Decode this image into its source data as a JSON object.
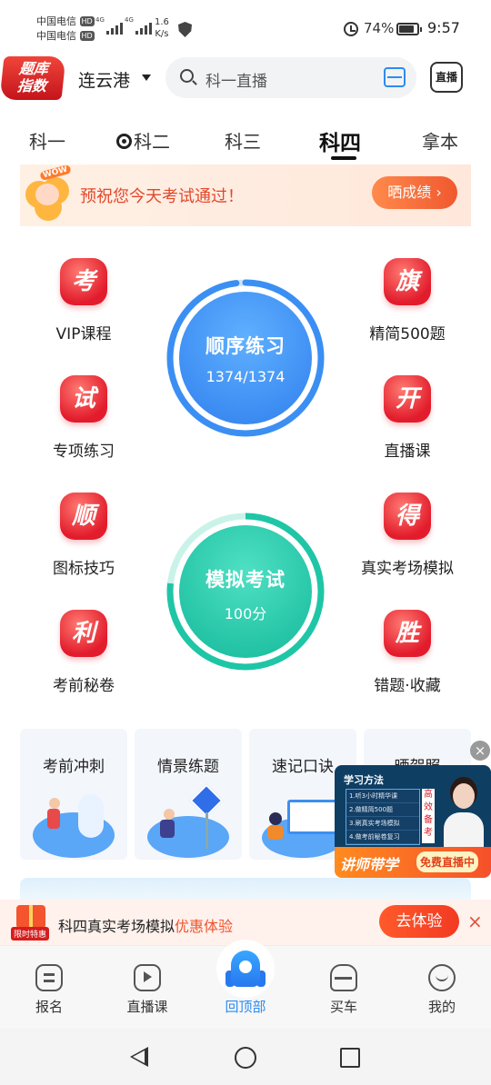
{
  "status": {
    "carrier1": "中国电信",
    "carrier2": "中国电信",
    "hd": "HD",
    "net1": "4G",
    "net2": "4G",
    "speed_value": "1.6",
    "speed_unit": "K/s",
    "battery": "74%",
    "time": "9:57"
  },
  "header": {
    "logo_line1": "题库",
    "logo_line2": "指数",
    "city": "连云港",
    "search_placeholder": "科一直播",
    "live_label": "直播"
  },
  "tabs": [
    {
      "label": "科一"
    },
    {
      "label": "科二"
    },
    {
      "label": "科三"
    },
    {
      "label": "科四"
    },
    {
      "label": "拿本"
    }
  ],
  "active_tab": "科四",
  "banner": {
    "badge": "WOW",
    "text": "预祝您今天考试通过！",
    "button": "晒成绩 ›"
  },
  "features": {
    "vip": {
      "icon_char": "考",
      "label": "VIP课程"
    },
    "jingjian": {
      "icon_char": "旗",
      "label": "精简500题"
    },
    "zhuanxiang": {
      "icon_char": "试",
      "label": "专项练习"
    },
    "zhibo": {
      "icon_char": "开",
      "label": "直播课"
    },
    "tubiao": {
      "icon_char": "顺",
      "label": "图标技巧"
    },
    "zhenshi": {
      "icon_char": "得",
      "label": "真实考场模拟"
    },
    "kaoqian": {
      "icon_char": "利",
      "label": "考前秘卷"
    },
    "cuoti": {
      "icon_char": "胜",
      "label": "错题·收藏"
    }
  },
  "practice": {
    "title": "顺序练习",
    "progress": "1374/1374",
    "progress_fraction": 1.0,
    "color": "#3b8ff3"
  },
  "exam": {
    "title": "模拟考试",
    "score": "100分",
    "color": "#1ec6a6"
  },
  "cards": [
    {
      "title": "考前冲刺"
    },
    {
      "title": "情景练题"
    },
    {
      "title": "速记口诀"
    },
    {
      "title": "晒贺照"
    }
  ],
  "float_promo": {
    "close": "×",
    "header": "学习方法",
    "items": [
      "1.听3小时精华课",
      "2.做精简500题",
      "3.刷真实考场模拟",
      "4.做考前秘卷复习"
    ],
    "side": "高效备考",
    "left_tag": "讲师带学",
    "right_tag": "免费直播中"
  },
  "offer": {
    "tag": "限时特惠",
    "text_main": "科四真实考场模拟",
    "text_highlight": "优惠体验",
    "button": "去体验",
    "close": "×"
  },
  "bottom_nav": [
    {
      "label": "报名",
      "icon": "register-icon"
    },
    {
      "label": "直播课",
      "icon": "live-class-icon"
    },
    {
      "label": "回顶部",
      "icon": "rocket-icon"
    },
    {
      "label": "买车",
      "icon": "car-icon"
    },
    {
      "label": "我的",
      "icon": "profile-icon"
    }
  ],
  "colors": {
    "accent_blue": "#2a8bf2",
    "accent_red": "#e21c2c",
    "accent_orange": "#f0582f"
  }
}
